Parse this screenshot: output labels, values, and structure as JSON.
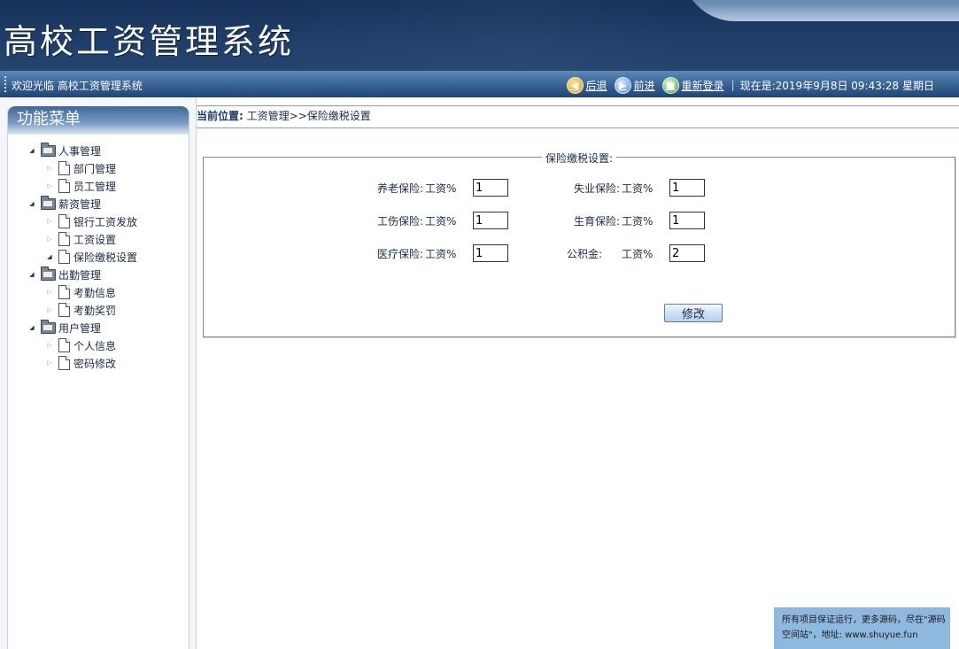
{
  "banner": {
    "title": "高校工资管理系统"
  },
  "topbar": {
    "welcome": "欢迎光临 高校工资管理系统",
    "back_label": "后退",
    "forward_label": "前进",
    "relogin_label": "重新登录",
    "datetime": "现在是:2019年9月8日 09:43:28 星期日"
  },
  "sidebar": {
    "title": "功能菜单",
    "groups": [
      {
        "label": "人事管理",
        "items": [
          "部门管理",
          "员工管理"
        ]
      },
      {
        "label": "薪资管理",
        "items": [
          "银行工资发放",
          "工资设置",
          "保险缴税设置"
        ]
      },
      {
        "label": "出勤管理",
        "items": [
          "考勤信息",
          "考勤奖罚"
        ]
      },
      {
        "label": "用户管理",
        "items": [
          "个人信息",
          "密码修改"
        ]
      }
    ],
    "selected_item": "保险缴税设置"
  },
  "breadcrumb": {
    "label": "当前位置:",
    "path": " 工资管理>>保险缴税设置"
  },
  "form": {
    "legend": "保险缴税设置:",
    "unit": "工资%",
    "fields": {
      "pension": {
        "label": "养老保险:",
        "value": "1"
      },
      "unemployment": {
        "label": "失业保险:",
        "value": "1"
      },
      "injury": {
        "label": "工伤保险:",
        "value": "1"
      },
      "maternity": {
        "label": "生育保险:",
        "value": "1"
      },
      "medical": {
        "label": "医疗保险:",
        "value": "1"
      },
      "housing_fund": {
        "label": "公积金:",
        "value": "2"
      }
    },
    "submit_label": "修改"
  },
  "promo": {
    "line1": "所有项目保证运行，更多源码，尽在\"源码",
    "line2": "空间站\"，地址: www.shuyue.fun"
  }
}
